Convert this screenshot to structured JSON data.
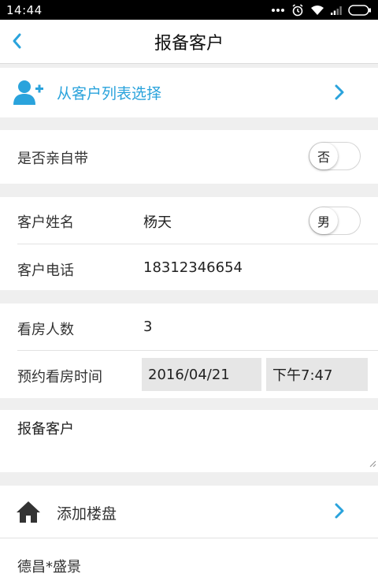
{
  "status_bar": {
    "time": "14:44"
  },
  "header": {
    "title": "报备客户"
  },
  "select_from_list": {
    "label": "从客户列表选择"
  },
  "self_bring": {
    "label": "是否亲自带",
    "toggle_text": "否"
  },
  "customer_name": {
    "label": "客户姓名",
    "value": "杨天",
    "gender_text": "男"
  },
  "customer_phone": {
    "label": "客户电话",
    "value": "18312346654"
  },
  "viewers": {
    "label": "看房人数",
    "value": "3"
  },
  "appointment": {
    "label": "预约看房时间",
    "date": "2016/04/21",
    "time": "下午7:47"
  },
  "remark": {
    "value": "报备客户"
  },
  "add_property": {
    "label": "添加楼盘"
  },
  "properties": [
    "德昌*盛景"
  ],
  "colors": {
    "accent": "#2aa3dc",
    "section_bg": "#efefef",
    "date_bg": "#e6e6e6"
  }
}
